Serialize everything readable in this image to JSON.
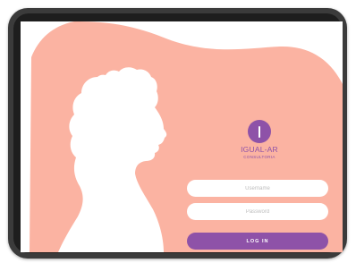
{
  "colors": {
    "salmon": "#fbb3a2",
    "purple": "#8e52a8",
    "white": "#ffffff",
    "placeholder": "#bdbdbd",
    "device_frame": "#3b3b3b",
    "device_bezel": "#1e1e1e"
  },
  "brand": {
    "logo_icon": "circle-with-vertical-bar",
    "name": "IGUAL-AR",
    "subtitle": "CONSULTORIA"
  },
  "form": {
    "username_placeholder": "Username",
    "password_placeholder": "Password",
    "login_label": "LOG IN"
  }
}
